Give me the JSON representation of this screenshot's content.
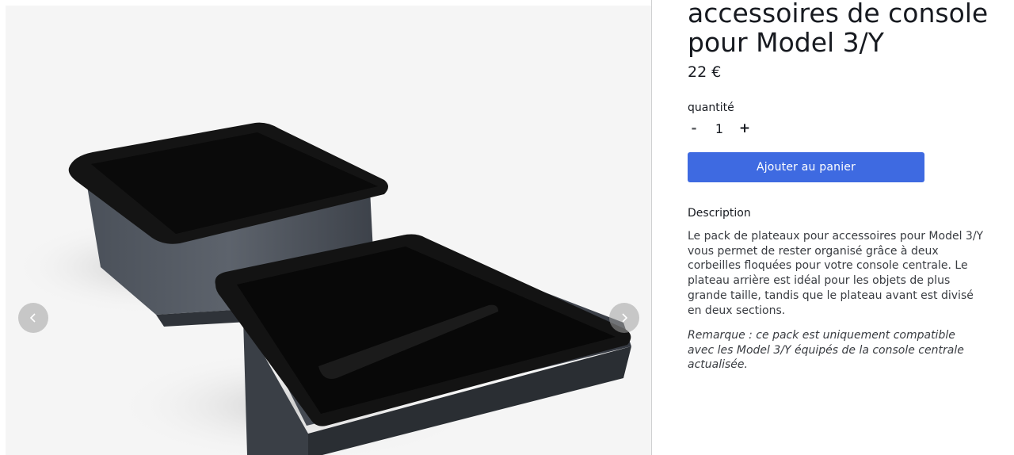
{
  "product": {
    "title_line1": "accessoires de console",
    "title_line2": "pour Model 3/Y",
    "price": "22 €",
    "image_alt": "Plateaux pour accessoires de console"
  },
  "quantity": {
    "label": "quantité",
    "minus": "-",
    "value": "1",
    "plus": "+"
  },
  "actions": {
    "add_to_cart": "Ajouter au panier"
  },
  "description": {
    "heading": "Description",
    "body": "Le pack de plateaux pour accessoires pour Model 3/Y vous permet de rester organisé grâce à deux corbeilles floquées pour votre console centrale. Le plateau arrière est idéal pour les objets de plus grande taille, tandis que le plateau avant est divisé en deux sections.",
    "note": "Remarque : ce pack est uniquement compatible avec les Model 3/Y équipés de la console centrale actualisée."
  },
  "gallery": {
    "prev_icon": "chevron-left-icon",
    "next_icon": "chevron-right-icon"
  },
  "colors": {
    "accent": "#3e6ae1",
    "text": "#171a20",
    "body_text": "#393c41",
    "gallery_bg": "#f4f4f4"
  }
}
